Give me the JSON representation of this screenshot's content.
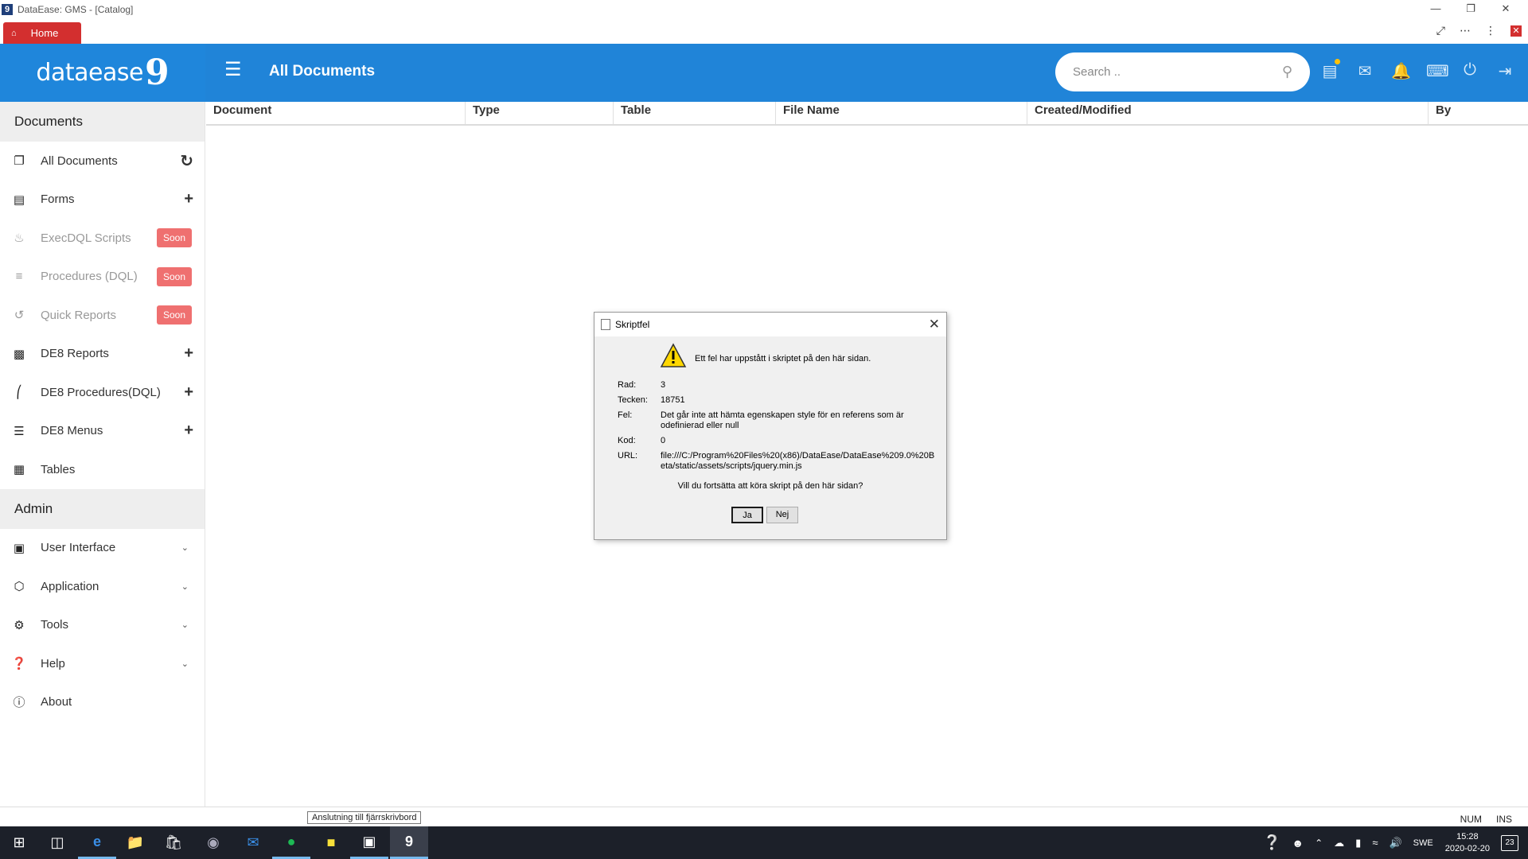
{
  "window": {
    "title": "DataEase: GMS - [Catalog]",
    "app_icon_glyph": "9"
  },
  "tabs": {
    "home_label": "Home"
  },
  "header": {
    "logo_text": "dataease",
    "logo_version": "9",
    "page_title": "All Documents",
    "search_placeholder": "Search ..",
    "accent_color": "#2084d8"
  },
  "sidebar": {
    "documents_heading": "Documents",
    "admin_heading": "Admin",
    "items": [
      {
        "label": "All Documents",
        "icon": "documents-icon",
        "action": "refresh-icon"
      },
      {
        "label": "Forms",
        "icon": "form-icon",
        "action": "plus-icon"
      },
      {
        "label": "ExecDQL Scripts",
        "icon": "flame-icon",
        "badge": "Soon"
      },
      {
        "label": "Procedures (DQL)",
        "icon": "list-icon",
        "badge": "Soon"
      },
      {
        "label": "Quick Reports",
        "icon": "history-icon",
        "badge": "Soon"
      },
      {
        "label": "DE8 Reports",
        "icon": "report-icon",
        "action": "plus-icon"
      },
      {
        "label": "DE8 Procedures(DQL)",
        "icon": "procedure-icon",
        "action": "plus-icon"
      },
      {
        "label": "DE8 Menus",
        "icon": "menu-icon",
        "action": "plus-icon"
      },
      {
        "label": "Tables",
        "icon": "table-icon"
      }
    ],
    "admin_items": [
      {
        "label": "User Interface",
        "icon": "monitor-icon"
      },
      {
        "label": "Application",
        "icon": "cube-icon"
      },
      {
        "label": "Tools",
        "icon": "gear-icon"
      },
      {
        "label": "Help",
        "icon": "question-icon"
      },
      {
        "label": "About",
        "icon": "info-icon"
      }
    ]
  },
  "table": {
    "columns": [
      "Document",
      "Type",
      "Table",
      "File Name",
      "Created/Modified",
      "By"
    ]
  },
  "dialog": {
    "title": "Skriptfel",
    "message": "Ett fel har uppstått i skriptet på den här sidan.",
    "fields": [
      {
        "key": "Rad:",
        "value": "3"
      },
      {
        "key": "Tecken:",
        "value": "18751"
      },
      {
        "key": "Fel:",
        "value": "Det går inte att hämta egenskapen style för en referens som är odefinierad eller null"
      },
      {
        "key": "Kod:",
        "value": "0"
      },
      {
        "key": "URL:",
        "value": "file:///C:/Program%20Files%20(x86)/DataEase/DataEase%209.0%20Beta/static/assets/scripts/jquery.min.js"
      }
    ],
    "question": "Vill du fortsätta att köra skript på den här sidan?",
    "yes_label": "Ja",
    "no_label": "Nej"
  },
  "status": {
    "tooltip": "Anslutning till fjärrskrivbord",
    "num": "NUM",
    "ins": "INS"
  },
  "taskbar": {
    "language": "SWE",
    "time": "15:28",
    "date": "2020-02-20",
    "notification_count": "23"
  }
}
